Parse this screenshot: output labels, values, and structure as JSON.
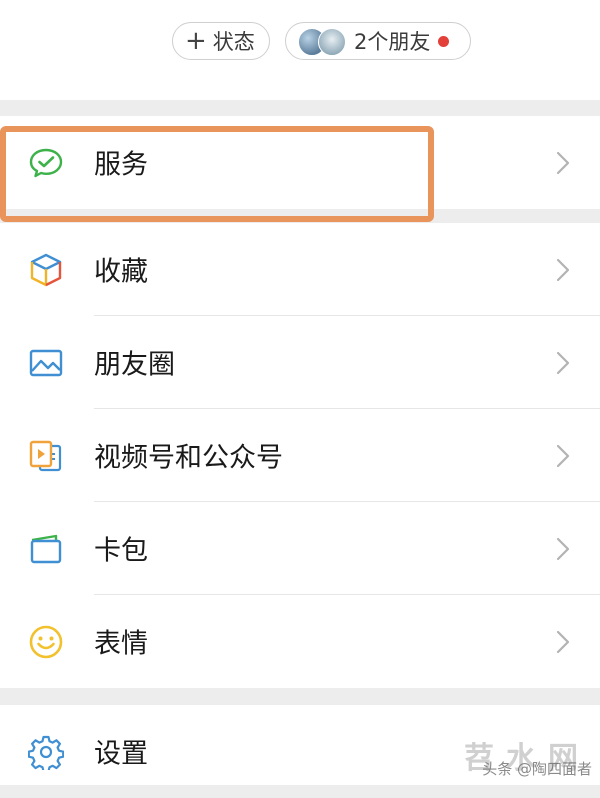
{
  "top": {
    "status_button": {
      "icon": "plus-icon",
      "label": "状态"
    },
    "friends_button": {
      "label": "2个朋友",
      "badge_color": "#e3403a"
    }
  },
  "menu": {
    "service": {
      "label": "服务",
      "icon": "wechat-check-icon"
    },
    "favorites": {
      "label": "收藏",
      "icon": "cube-icon"
    },
    "moments": {
      "label": "朋友圈",
      "icon": "picture-icon"
    },
    "channels": {
      "label": "视频号和公众号",
      "icon": "video-icon"
    },
    "cards": {
      "label": "卡包",
      "icon": "wallet-icon"
    },
    "stickers": {
      "label": "表情",
      "icon": "smiley-icon"
    },
    "settings": {
      "label": "设置",
      "icon": "gear-icon"
    }
  },
  "highlight_color": "#e8945a",
  "watermark": {
    "site": "苕水网",
    "credit": "头条 @陶四面者"
  }
}
